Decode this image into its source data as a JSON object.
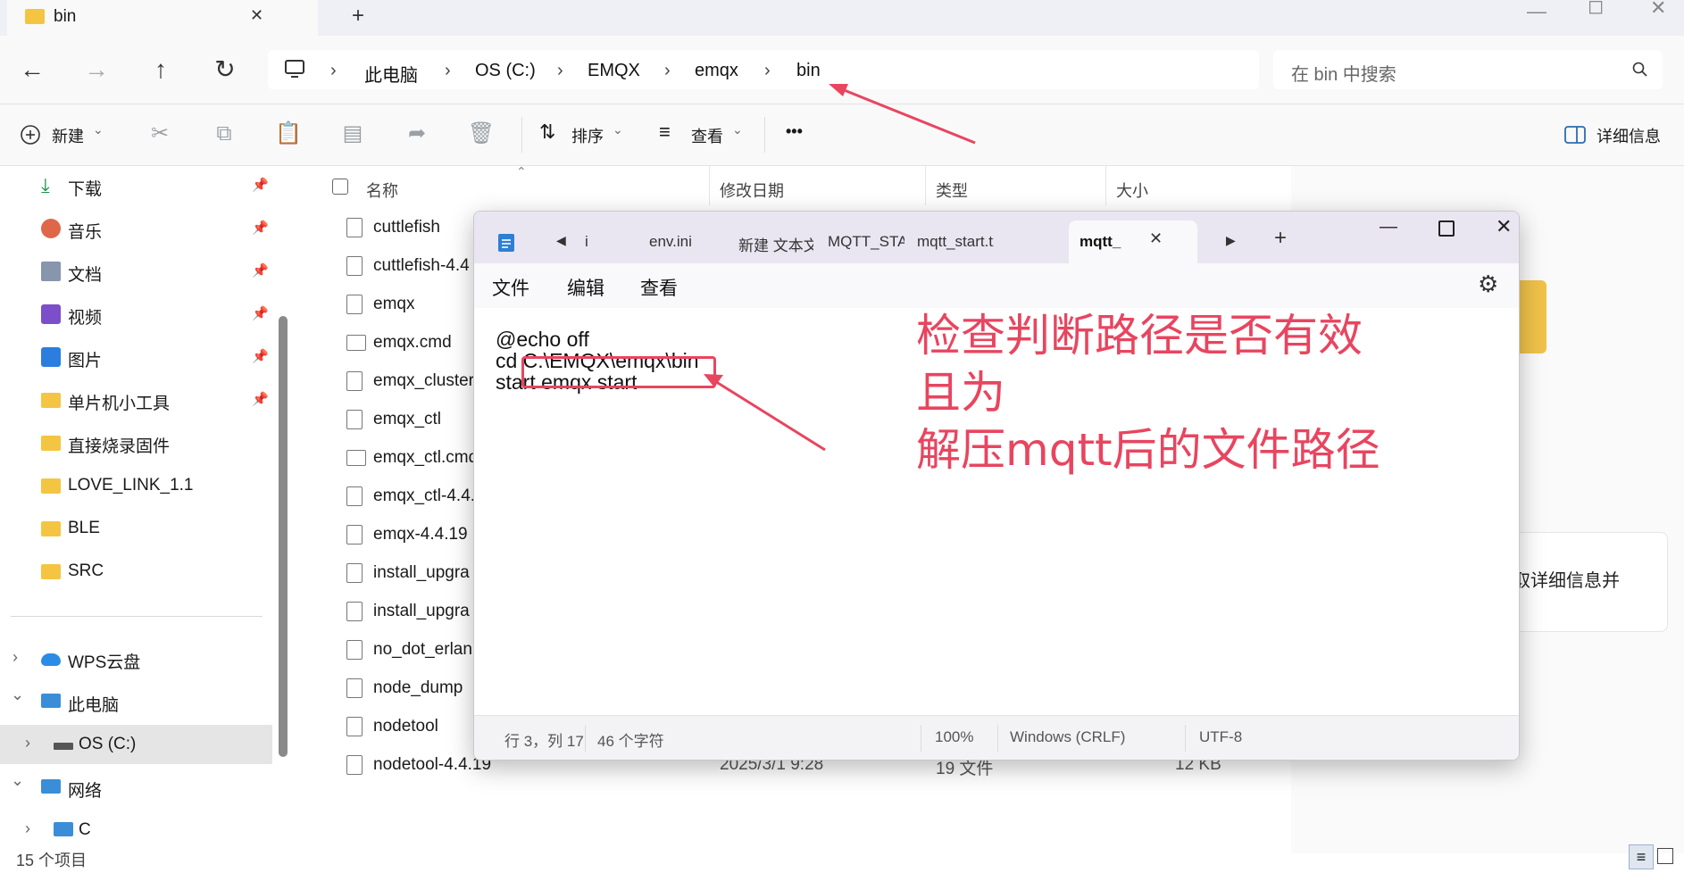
{
  "explorer": {
    "tab_title": "bin",
    "tab_close": "✕",
    "new_tab": "+",
    "breadcrumb": [
      "此电脑",
      "OS (C:)",
      "EMQX",
      "emqx",
      "bin"
    ],
    "search_placeholder": "在 bin 中搜索",
    "toolbar": {
      "new_label": "新建",
      "sort_label": "排序",
      "view_label": "查看",
      "more_label": "•••",
      "details_label": "详细信息"
    },
    "sidebar": {
      "quick": [
        {
          "label": "下载",
          "icon": "download-icon",
          "pinned": true
        },
        {
          "label": "音乐",
          "icon": "music-icon",
          "pinned": true
        },
        {
          "label": "文档",
          "icon": "document-icon",
          "pinned": true
        },
        {
          "label": "视频",
          "icon": "video-icon",
          "pinned": true
        },
        {
          "label": "图片",
          "icon": "picture-icon",
          "pinned": true
        },
        {
          "label": "单片机小工具",
          "icon": "folder-icon",
          "pinned": true
        },
        {
          "label": "直接烧录固件",
          "icon": "folder-icon",
          "pinned": false
        },
        {
          "label": "LOVE_LINK_1.1",
          "icon": "folder-icon",
          "pinned": false
        },
        {
          "label": "BLE",
          "icon": "folder-icon",
          "pinned": false
        },
        {
          "label": "SRC",
          "icon": "folder-icon",
          "pinned": false
        }
      ],
      "tree": [
        {
          "label": "WPS云盘",
          "icon": "cloud-icon"
        },
        {
          "label": "此电脑",
          "icon": "pc-icon"
        },
        {
          "label": "OS (C:)",
          "icon": "drive-icon"
        },
        {
          "label": "网络",
          "icon": "network-icon"
        },
        {
          "label": "C",
          "icon": "pc-icon"
        }
      ]
    },
    "columns": {
      "name": "名称",
      "modified": "修改日期",
      "type": "类型",
      "size": "大小"
    },
    "files": [
      {
        "name": "cuttlefish"
      },
      {
        "name": "cuttlefish-4.4"
      },
      {
        "name": "emqx"
      },
      {
        "name": "emqx.cmd"
      },
      {
        "name": "emqx_cluster"
      },
      {
        "name": "emqx_ctl"
      },
      {
        "name": "emqx_ctl.cmd"
      },
      {
        "name": "emqx_ctl-4.4."
      },
      {
        "name": "emqx-4.4.19"
      },
      {
        "name": "install_upgra"
      },
      {
        "name": "install_upgra"
      },
      {
        "name": "no_dot_erlan"
      },
      {
        "name": "node_dump"
      },
      {
        "name": "nodetool"
      },
      {
        "name": "nodetool-4.4.19",
        "modified": "2025/3/1 9:28",
        "type": "19 文件",
        "size": "12 KB"
      }
    ],
    "details_partial_text": "获取详细信息并",
    "status_count": "15 个项目"
  },
  "notepad": {
    "tabs": [
      "i",
      "env.ini",
      "新建 文本文|",
      "MQTT_STAR'",
      "mqtt_start.tx",
      "mqtt_"
    ],
    "active_tab": "mqtt_",
    "menu": [
      "文件",
      "编辑",
      "查看"
    ],
    "lines": [
      "@echo off",
      "cd C:\\EMQX\\emqx\\bin",
      "start emqx start"
    ],
    "status": {
      "position": "行 3，列 17",
      "chars": "46 个字符",
      "zoom": "100%",
      "line_ending": "Windows (CRLF)",
      "encoding": "UTF-8"
    }
  },
  "annotation": {
    "line1": "检查判断路径是否有效且为",
    "line2": "解压mqtt后的文件路径",
    "color": "#e8455f"
  }
}
